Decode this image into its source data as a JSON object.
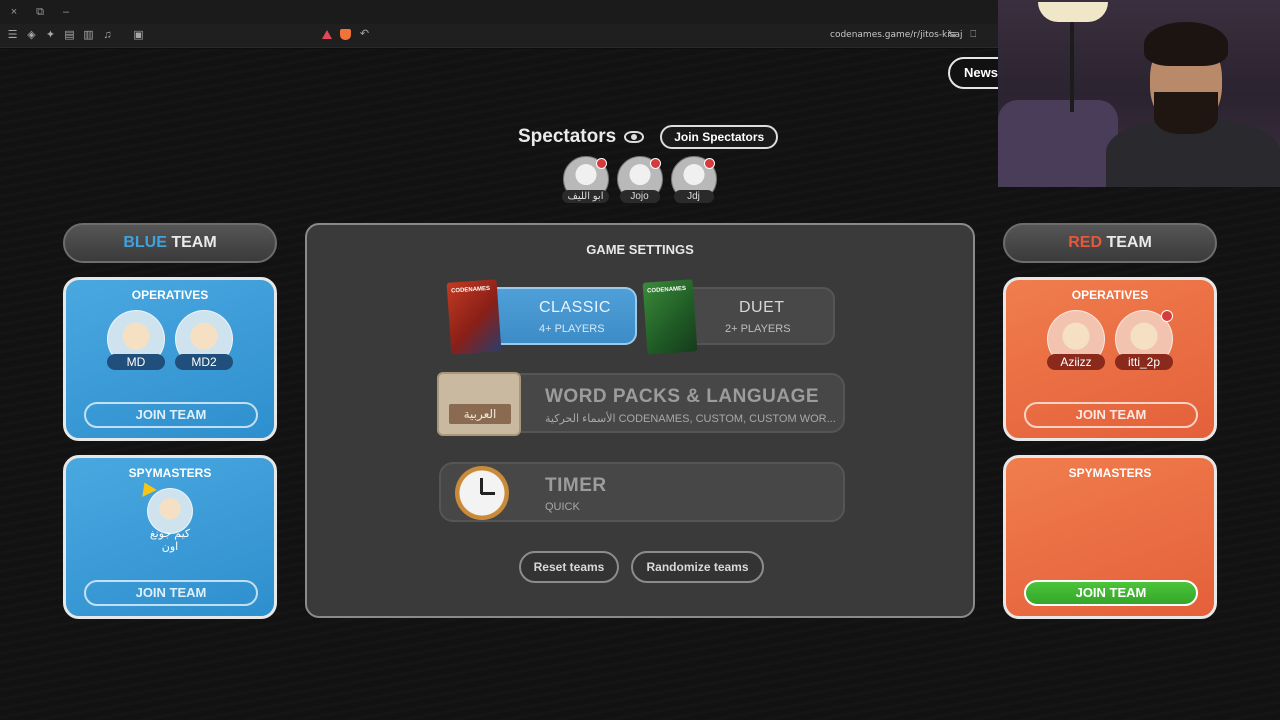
{
  "browser": {
    "url": "codenames.game/r/jitos-kisaj",
    "window_buttons": [
      "×",
      "⧉",
      "–"
    ]
  },
  "page": {
    "news_label": "News",
    "spectators": {
      "title": "Spectators",
      "join_label": "Join Spectators",
      "members": [
        "ابو الليف",
        "Jojo",
        "Jdj"
      ]
    },
    "blue_team": {
      "title_color_word": "BLUE",
      "title_rest": " TEAM",
      "operatives_title": "OPERATIVES",
      "operatives": [
        "MD",
        "MD2"
      ],
      "operatives_join": "JOIN TEAM",
      "spymasters_title": "SPYMASTERS",
      "spymasters": [
        "كيم جونغ اون"
      ],
      "spymasters_join": "JOIN TEAM"
    },
    "red_team": {
      "title_color_word": "RED",
      "title_rest": " TEAM",
      "operatives_title": "OPERATIVES",
      "operatives": [
        "Aziizz",
        "itti_2p"
      ],
      "operatives_join": "JOIN TEAM",
      "spymasters_title": "SPYMASTERS",
      "spymasters_join": "JOIN TEAM"
    },
    "settings": {
      "title": "GAME SETTINGS",
      "modes": [
        {
          "name": "CLASSIC",
          "sub": "4+ PLAYERS",
          "box_text": "CODENAMES",
          "active": true
        },
        {
          "name": "DUET",
          "sub": "2+ PLAYERS",
          "box_text": "CODENAMES",
          "active": false
        }
      ],
      "word_packs": {
        "title": "WORD PACKS & LANGUAGE",
        "sub": "الأسماء الحركية CODENAMES, CUSTOM, CUSTOM WOR...",
        "language_label": "العربية"
      },
      "timer": {
        "title": "TIMER",
        "sub": "QUICK"
      },
      "reset_label": "Reset teams",
      "randomize_label": "Randomize teams"
    }
  },
  "colors": {
    "blue_accent": "#3fa3e0",
    "red_accent": "#e8573a",
    "join_green": "#4cc43a",
    "classic_active": "#4f9fd8"
  }
}
